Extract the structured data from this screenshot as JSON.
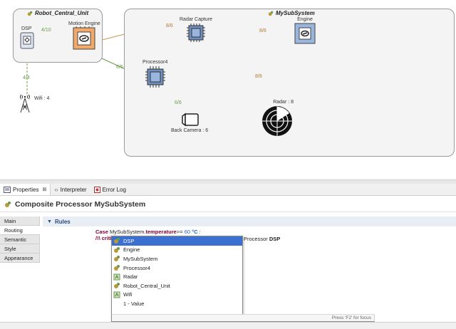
{
  "diagram": {
    "robot_unit": {
      "title": "Robot_Central_Unit"
    },
    "subsystem": {
      "title": "MySubSystem"
    },
    "nodes": {
      "dsp": "DSP",
      "motion_engine": "Motion Engine",
      "radar_capture": "Radar Capture",
      "engine": "Engine",
      "processor4": "Processor4",
      "wifi": "Wifi : 4",
      "back_camera": "Back Camera : 6",
      "radar": "Radar : 8"
    },
    "links": {
      "dsp_motion": "4/10",
      "wifi_dsp": "4/4",
      "motion_radar": "8/6",
      "radar_engine": "8/6",
      "motion_processor": "6/6",
      "radar_radar": "8/8",
      "camera_processor": "6/6"
    }
  },
  "tabs": [
    {
      "label": "Properties",
      "close": "⊠"
    },
    {
      "label": "Interpreter"
    },
    {
      "label": "Error Log"
    }
  ],
  "properties": {
    "title": "Composite Processor MySubSystem",
    "side_tabs": [
      "Main",
      "Routing",
      "Semantic",
      "Style",
      "Appearance"
    ],
    "section": "Rules"
  },
  "rule": {
    "case_kw": "Case",
    "subject": "MySubSystem.",
    "attribute": "temperature",
    "op": ">=",
    "value": "60",
    "unit": "°C",
    "colon": ":",
    "comment_prefix": "/!\\ criti",
    "target_kw": "Processor",
    "target": "DSP"
  },
  "completion": {
    "items": [
      {
        "label": "DSP",
        "icon": "processor-icon"
      },
      {
        "label": "Engine",
        "icon": "processor-icon"
      },
      {
        "label": "MySubSystem",
        "icon": "processor-icon"
      },
      {
        "label": "Processor4",
        "icon": "processor-icon"
      },
      {
        "label": "Radar",
        "icon": "sensor-icon"
      },
      {
        "label": "Robot_Central_Unit",
        "icon": "processor-icon"
      },
      {
        "label": "Wifi",
        "icon": "sensor-icon"
      },
      {
        "label": "1 - Value",
        "icon": ""
      }
    ],
    "selected_index": 0,
    "hint": "Press 'F2' for focus"
  },
  "colors": {
    "accent": "#3b6fd0",
    "link_orange": "#c9964e",
    "link_green": "#6a9b4a"
  }
}
